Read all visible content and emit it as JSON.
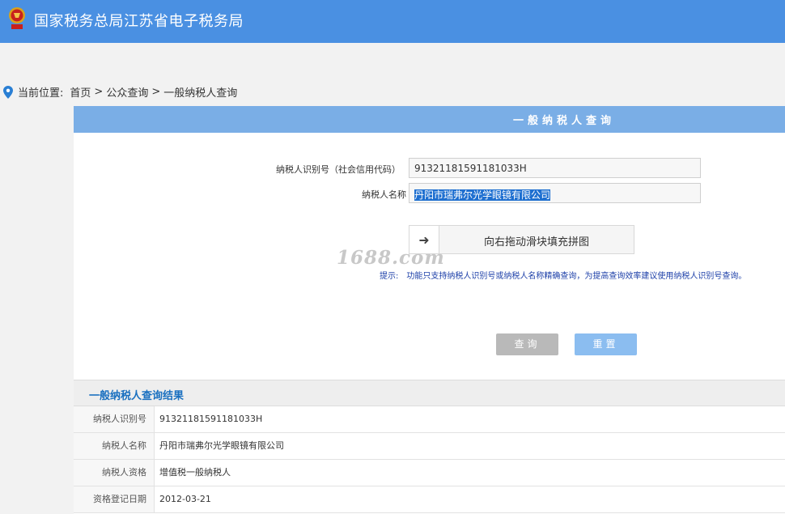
{
  "header": {
    "title": "国家税务总局江苏省电子税务局",
    "brand_color": "#4a90e2"
  },
  "breadcrumb": {
    "label": "当前位置:",
    "items": [
      "首页",
      "公众查询",
      "一般纳税人查询"
    ],
    "separator": ">"
  },
  "panel": {
    "title": "一般纳税人查询"
  },
  "form": {
    "taxpayer_id_label": "纳税人识别号（社会信用代码）",
    "taxpayer_id_value": "91321181591181033H",
    "taxpayer_name_label": "纳税人名称",
    "taxpayer_name_value": "丹阳市瑞弗尔光学眼镜有限公司",
    "slider_arrow": "➜",
    "slider_text": "向右拖动滑块填充拼图",
    "hint_label": "提示:",
    "hint_text": "功能只支持纳税人识别号或纳税人名称精确查询，为提高查询效率建议使用纳税人识别号查询。",
    "query_button": "查询",
    "reset_button": "重置"
  },
  "watermark": "1688.com",
  "results": {
    "title": "一般纳税人查询结果",
    "rows": [
      {
        "key": "纳税人识别号",
        "value": "91321181591181033H"
      },
      {
        "key": "纳税人名称",
        "value": "丹阳市瑞弗尔光学眼镜有限公司"
      },
      {
        "key": "纳税人资格",
        "value": "增值税一般纳税人"
      },
      {
        "key": "资格登记日期",
        "value": "2012-03-21"
      }
    ]
  },
  "icons": {
    "emblem": "tax-emblem-icon",
    "location": "location-pin-icon",
    "slider": "arrow-right-icon"
  }
}
